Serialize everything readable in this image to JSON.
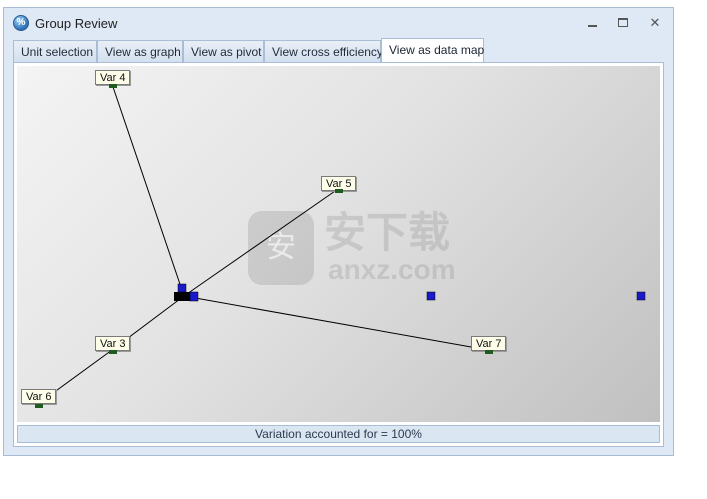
{
  "window": {
    "title": "Group Review",
    "app_icon": "%",
    "buttons": {
      "minimize": "minimize-icon",
      "maximize": "maximize-icon",
      "close": "close-icon"
    }
  },
  "tabs": [
    {
      "label": "Unit selection",
      "active": false
    },
    {
      "label": "View as graph",
      "active": false
    },
    {
      "label": "View as pivot",
      "active": false
    },
    {
      "label": "View cross efficiency",
      "active": false
    },
    {
      "label": "View as data map",
      "active": true
    }
  ],
  "map": {
    "variables": [
      {
        "label": "Var 4"
      },
      {
        "label": "Var 5"
      },
      {
        "label": "Var 3"
      },
      {
        "label": "Var 6"
      },
      {
        "label": "Var 7"
      }
    ],
    "units_color": "#1a1acc",
    "line_color": "#000000"
  },
  "watermark": {
    "glyph": "安",
    "text_cn": "安下载",
    "text_en": "anxz.com"
  },
  "status": {
    "text": "Variation accounted for = 100%"
  }
}
